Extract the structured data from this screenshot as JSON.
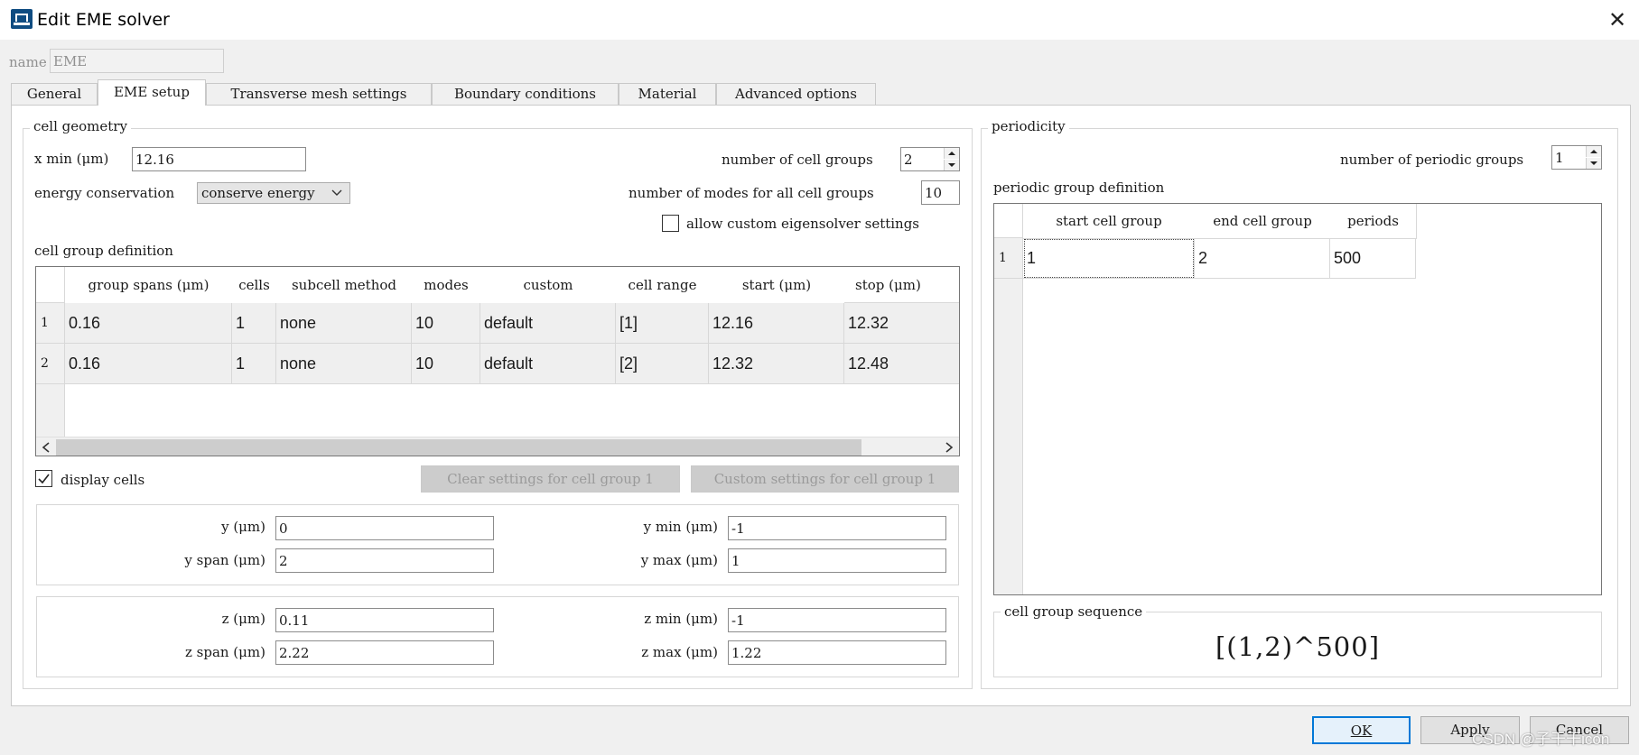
{
  "window": {
    "title": "Edit EME solver",
    "name_label": "name",
    "name_value": "EME"
  },
  "tabs": [
    {
      "label": "General",
      "active": false
    },
    {
      "label": "EME setup",
      "active": true
    },
    {
      "label": "Transverse mesh settings",
      "active": false
    },
    {
      "label": "Boundary conditions",
      "active": false
    },
    {
      "label": "Material",
      "active": false
    },
    {
      "label": "Advanced options",
      "active": false
    }
  ],
  "cell_geometry": {
    "title": "cell geometry",
    "x_min_label": "x min (μm)",
    "x_min_value": "12.16",
    "num_cell_groups_label": "number of cell groups",
    "num_cell_groups_value": "2",
    "energy_conservation_label": "energy conservation",
    "energy_conservation_value": "conserve energy",
    "num_modes_label": "number of modes for all cell groups",
    "num_modes_value": "10",
    "allow_custom_label": "allow custom eigensolver settings",
    "allow_custom_checked": false,
    "cell_group_definition_label": "cell group definition",
    "table": {
      "headers": [
        "group spans (μm)",
        "cells",
        "subcell method",
        "modes",
        "custom",
        "cell range",
        "start (μm)",
        "stop (μm)"
      ],
      "rows": [
        {
          "index": "1",
          "cells": [
            "0.16",
            "1",
            "none",
            "10",
            "default",
            "[1]",
            "12.16",
            "12.32"
          ]
        },
        {
          "index": "2",
          "cells": [
            "0.16",
            "1",
            "none",
            "10",
            "default",
            "[2]",
            "12.32",
            "12.48"
          ]
        }
      ]
    },
    "display_cells_label": "display cells",
    "display_cells_checked": true,
    "clear_settings_label": "Clear settings for cell group 1",
    "custom_settings_label": "Custom settings for cell group 1",
    "y_label": "y (μm)",
    "y_value": "0",
    "y_span_label": "y span (μm)",
    "y_span_value": "2",
    "y_min_label": "y min (μm)",
    "y_min_value": "-1",
    "y_max_label": "y max (μm)",
    "y_max_value": "1",
    "z_label": "z (μm)",
    "z_value": "0.11",
    "z_span_label": "z span (μm)",
    "z_span_value": "2.22",
    "z_min_label": "z min (μm)",
    "z_min_value": "-1",
    "z_max_label": "z max (μm)",
    "z_max_value": "1.22"
  },
  "periodicity": {
    "title": "periodicity",
    "num_periodic_groups_label": "number of periodic groups",
    "num_periodic_groups_value": "1",
    "periodic_group_definition_label": "periodic group definition",
    "table": {
      "headers": [
        "start cell group",
        "end cell group",
        "periods"
      ],
      "rows": [
        {
          "index": "1",
          "cells": [
            "1",
            "2",
            "500"
          ]
        }
      ]
    },
    "sequence_title": "cell group sequence",
    "sequence_value": "[(1,2)^500]"
  },
  "footer": {
    "ok_label": "OK",
    "apply_label": "Apply",
    "cancel_label": "Cancel",
    "watermark": "CSDN @子干干icon"
  },
  "icons": {
    "app": "app-window-icon",
    "close": "close-icon",
    "combo_arrow": "chevron-down-icon",
    "spin_up": "spin-up-icon",
    "spin_down": "spin-down-icon",
    "scroll_left": "scroll-left-icon",
    "scroll_right": "scroll-right-icon",
    "check": "checkmark-icon"
  },
  "colors": {
    "default_button_border": "#0078d7",
    "app_icon": "#0f4c81",
    "selected_row_background": "#efefef"
  }
}
